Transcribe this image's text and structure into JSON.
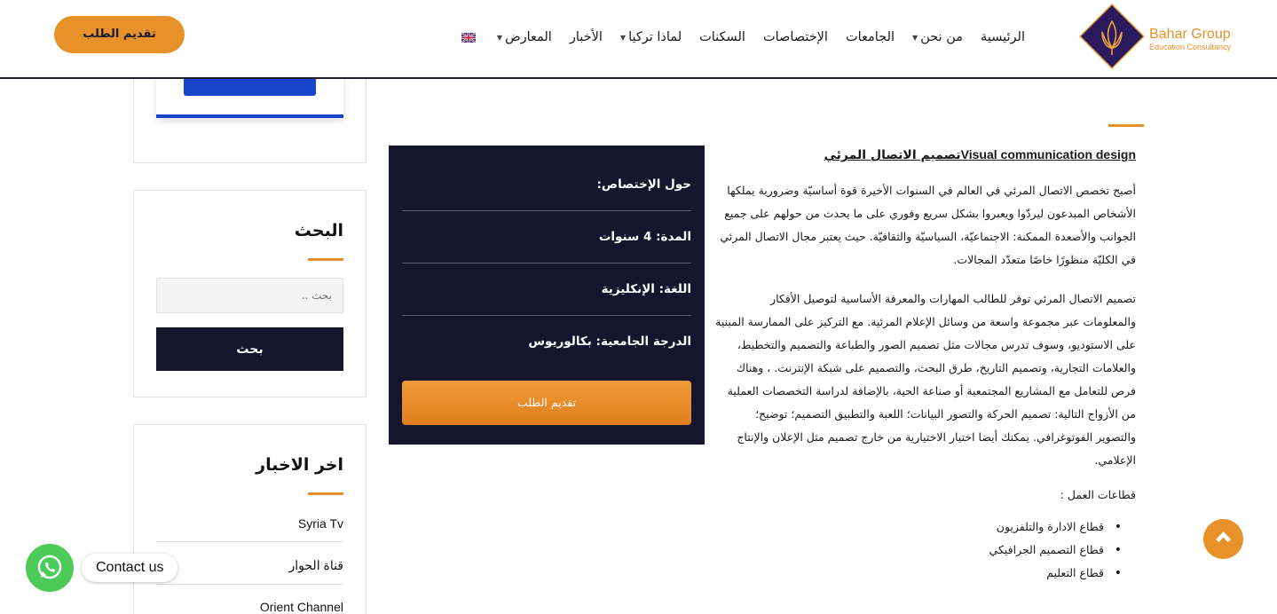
{
  "header": {
    "brand_name": "Bahar Group",
    "brand_sub": "Education Consultancy",
    "apply_label": "تقديم الطلب",
    "nav": [
      {
        "label": "الرئيسية",
        "has_caret": false
      },
      {
        "label": "من نحن",
        "has_caret": true
      },
      {
        "label": "الجامعات",
        "has_caret": false
      },
      {
        "label": "الإختصاصات",
        "has_caret": false
      },
      {
        "label": "السكنات",
        "has_caret": false
      },
      {
        "label": "لماذا تركيا",
        "has_caret": true
      },
      {
        "label": "الأخبار",
        "has_caret": false
      },
      {
        "label": "المعارض",
        "has_caret": true
      }
    ],
    "language_flag": "uk-flag-icon"
  },
  "sidebar": {
    "search": {
      "title": "البحث",
      "placeholder": "بحث ..",
      "button_label": "بحث"
    },
    "news": {
      "title": "اخر الاخبار",
      "items": [
        "Syria Tv",
        "قناة الحوار",
        "Orient Channel"
      ]
    }
  },
  "info_box": {
    "rows": [
      "حول الإختصاص:",
      "المدة: 4 سنوات",
      "اللغة: الإنكليزية",
      "الدرجة الجامعية: بكالوريوس"
    ],
    "apply_label": "تقديم الطلب"
  },
  "article": {
    "title_en": "Visual communication design",
    "title_ar": "تصميم الاتصال المرئي",
    "paragraph1": "أصبح تخصص الاتصال المرئي في العالم في السنوات الأخيرة قوة أساسيّة وضرورية يملكها الأشخاص المبدعون ليردّوا ويعبروا بشكل سريع وفوري على ما يحدث من حولهم على جميع الجوانب والأصعدة الممكنة: الاجتماعيّة، السياسيّة والثقافيّة. حيث يعتبر مجال الاتصال المرئي في الكليّة منظورًا خاصًا متعدّد المجالات.",
    "paragraph2": "تصميم الاتصال المرئي توفر للطالب المهارات والمعرفة الأساسية لتوصيل الأفكار والمعلومات عبر مجموعة واسعة من وسائل الإعلام المرئية. مع التركيز على الممارسة المبنية على الاستوديو، وسوف تدرس مجالات مثل تصميم الصور والطباعة والتصميم والتخطيط، والعلامات التجارية، وتصميم التاريخ، طرق البحث، والتصميم على شبكة الإنترنت. ، وهناك فرص للتعامل مع المشاريع المجتمعية أو صناعة الحية، بالإضافة لدراسة التخصصات العملية من الأزواج التالية: تصميم الحركة والتصور البيانات؛ اللعبة والتطبيق التصميم؛ توضيح؛ والتصوير الفوتوغرافي. يمكنك أيضا اختيار الاختيارية من خارج تصميم مثل الإعلان والإنتاج الإعلامي.",
    "sectors_heading": "قطاعات العمل :",
    "sectors": [
      "قطاع الادارة والتلفزيون",
      "قطاع التصميم الجرافيكي",
      "قطاع التعليم"
    ]
  },
  "floating": {
    "contact_label": "Contact us"
  },
  "colors": {
    "accent": "#e8912a",
    "navy": "#15152e",
    "blue": "#1745c9",
    "whatsapp": "#4ccb5a"
  }
}
